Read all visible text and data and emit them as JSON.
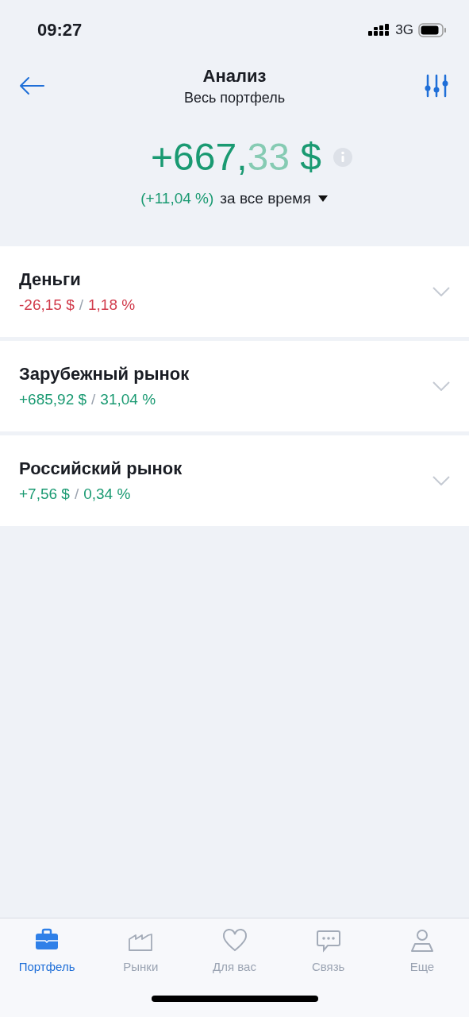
{
  "status_bar": {
    "time": "09:27",
    "network": "3G"
  },
  "header": {
    "title": "Анализ",
    "subtitle": "Весь портфель"
  },
  "total": {
    "whole": "+667,",
    "fraction": "33",
    "currency": "$",
    "change": "(+11,04 %)",
    "period": "за все время"
  },
  "groups": [
    {
      "name": "Деньги",
      "amount": "-26,15 $",
      "separator": "/",
      "percent": "1,18 %",
      "color": "#d13b4b",
      "expanded": false
    },
    {
      "name": "Зарубежный рынок",
      "amount": "+685,92 $",
      "separator": "/",
      "percent": "31,04 %",
      "color": "#1a9a72",
      "expanded": false
    },
    {
      "name": "Российский рынок",
      "amount": "+7,56 $",
      "separator": "/",
      "percent": "0,34 %",
      "color": "#1a9a72",
      "expanded": false
    }
  ],
  "tabs": [
    {
      "label": "Портфель",
      "selected": true
    },
    {
      "label": "Рынки",
      "selected": false
    },
    {
      "label": "Для вас",
      "selected": false
    },
    {
      "label": "Связь",
      "selected": false
    },
    {
      "label": "Еще",
      "selected": false
    }
  ]
}
